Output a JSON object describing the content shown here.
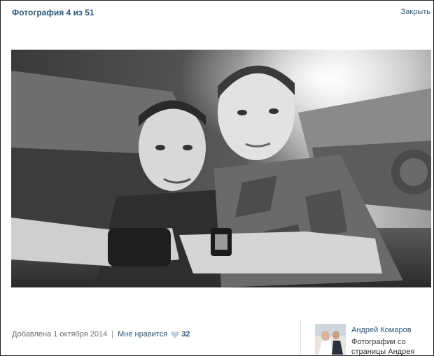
{
  "header": {
    "title": "Фотография 4 из 51",
    "close_label": "Закрыть"
  },
  "photo": {
    "description_icon": "photo-image"
  },
  "footer": {
    "added_text": "Добавлена 1 октября 2014",
    "separator": "|",
    "like_label": "Мне нравится",
    "like_count": "32",
    "heart_icon": "heart-icon"
  },
  "author": {
    "name": "Андрей Комаров",
    "subtitle": "Фотографии со страницы Андрея"
  },
  "colors": {
    "link": "#2b587a",
    "muted": "#6d6d6d",
    "divider": "#d9e0e7"
  }
}
